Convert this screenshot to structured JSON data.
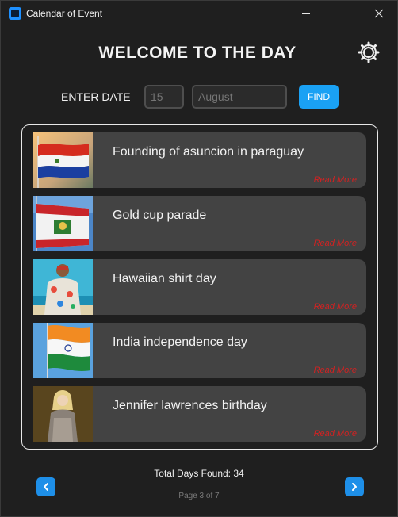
{
  "window": {
    "title": "Calendar of Event",
    "controls": {
      "minimize": "minimize",
      "maximize": "maximize",
      "close": "close"
    }
  },
  "header": {
    "title": "WELCOME TO THE DAY",
    "settings_icon": "gear-icon"
  },
  "search": {
    "label": "ENTER DATE",
    "day_placeholder": "15",
    "month_placeholder": "August",
    "find_label": "FIND"
  },
  "events": [
    {
      "title": "Founding of asuncion in paraguay",
      "read_more": "Read More",
      "thumbnail": "paraguay-flag"
    },
    {
      "title": "Gold cup parade",
      "read_more": "Read More",
      "thumbnail": "flag-with-crown"
    },
    {
      "title": "Hawaiian shirt day",
      "read_more": "Read More",
      "thumbnail": "person-in-hawaiian-shirt"
    },
    {
      "title": "India independence day",
      "read_more": "Read More",
      "thumbnail": "india-flag"
    },
    {
      "title": "Jennifer lawrences birthday",
      "read_more": "Read More",
      "thumbnail": "person-portrait"
    }
  ],
  "footer": {
    "total": "Total Days Found: 34",
    "page": "Page 3 of 7",
    "prev_icon": "chevron-left-icon",
    "next_icon": "chevron-right-icon"
  },
  "colors": {
    "background": "#1f1f1f",
    "card": "#434343",
    "accent": "#1aa1f4",
    "read_more": "#d22222"
  }
}
